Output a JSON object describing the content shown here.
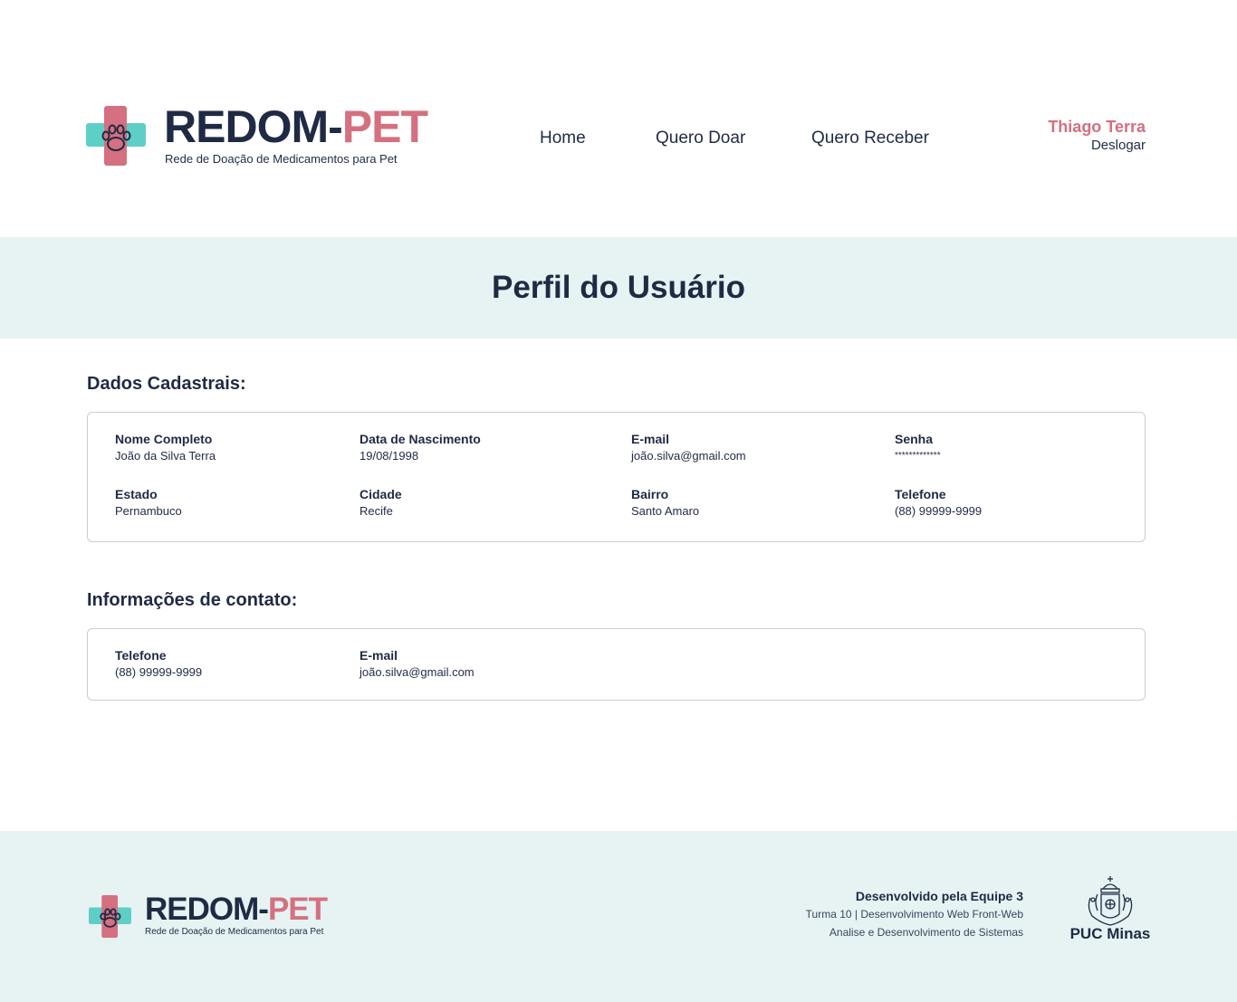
{
  "header": {
    "brand_part1": "REDOM-",
    "brand_part2": "PET",
    "tagline": "Rede de Doação de Medicamentos para Pet",
    "nav": [
      "Home",
      "Quero Doar",
      "Quero Receber"
    ],
    "user_name": "Thiago Terra",
    "logout_label": "Deslogar"
  },
  "page_title": "Perfil do Usuário",
  "registration": {
    "title": "Dados Cadastrais:",
    "fields": [
      {
        "label": "Nome Completo",
        "value": "João da Silva Terra"
      },
      {
        "label": "Data de Nascimento",
        "value": "19/08/1998"
      },
      {
        "label": "E-mail",
        "value": "joão.silva@gmail.com"
      },
      {
        "label": "Senha",
        "value": "*************"
      },
      {
        "label": "Estado",
        "value": "Pernambuco"
      },
      {
        "label": "Cidade",
        "value": "Recife"
      },
      {
        "label": "Bairro",
        "value": "Santo Amaro"
      },
      {
        "label": "Telefone",
        "value": "(88) 99999-9999"
      }
    ]
  },
  "contact": {
    "title": "Informações de contato:",
    "fields": [
      {
        "label": "Telefone",
        "value": "(88) 99999-9999"
      },
      {
        "label": "E-mail",
        "value": "joão.silva@gmail.com"
      }
    ]
  },
  "footer": {
    "brand_part1": "REDOM-",
    "brand_part2": "PET",
    "tagline": "Rede de Doação de Medicamentos para Pet",
    "team": "Desenvolvido pela Equipe 3",
    "course": "Turma 10 | Desenvolvimento Web Front-Web",
    "program": "Analise e Desenvolvimento de Sistemas",
    "university": "PUC Minas"
  },
  "colors": {
    "navy": "#1f2a44",
    "pink": "#d4707f",
    "teal": "#5ecfc6",
    "banner_bg": "#e6f3f2"
  }
}
